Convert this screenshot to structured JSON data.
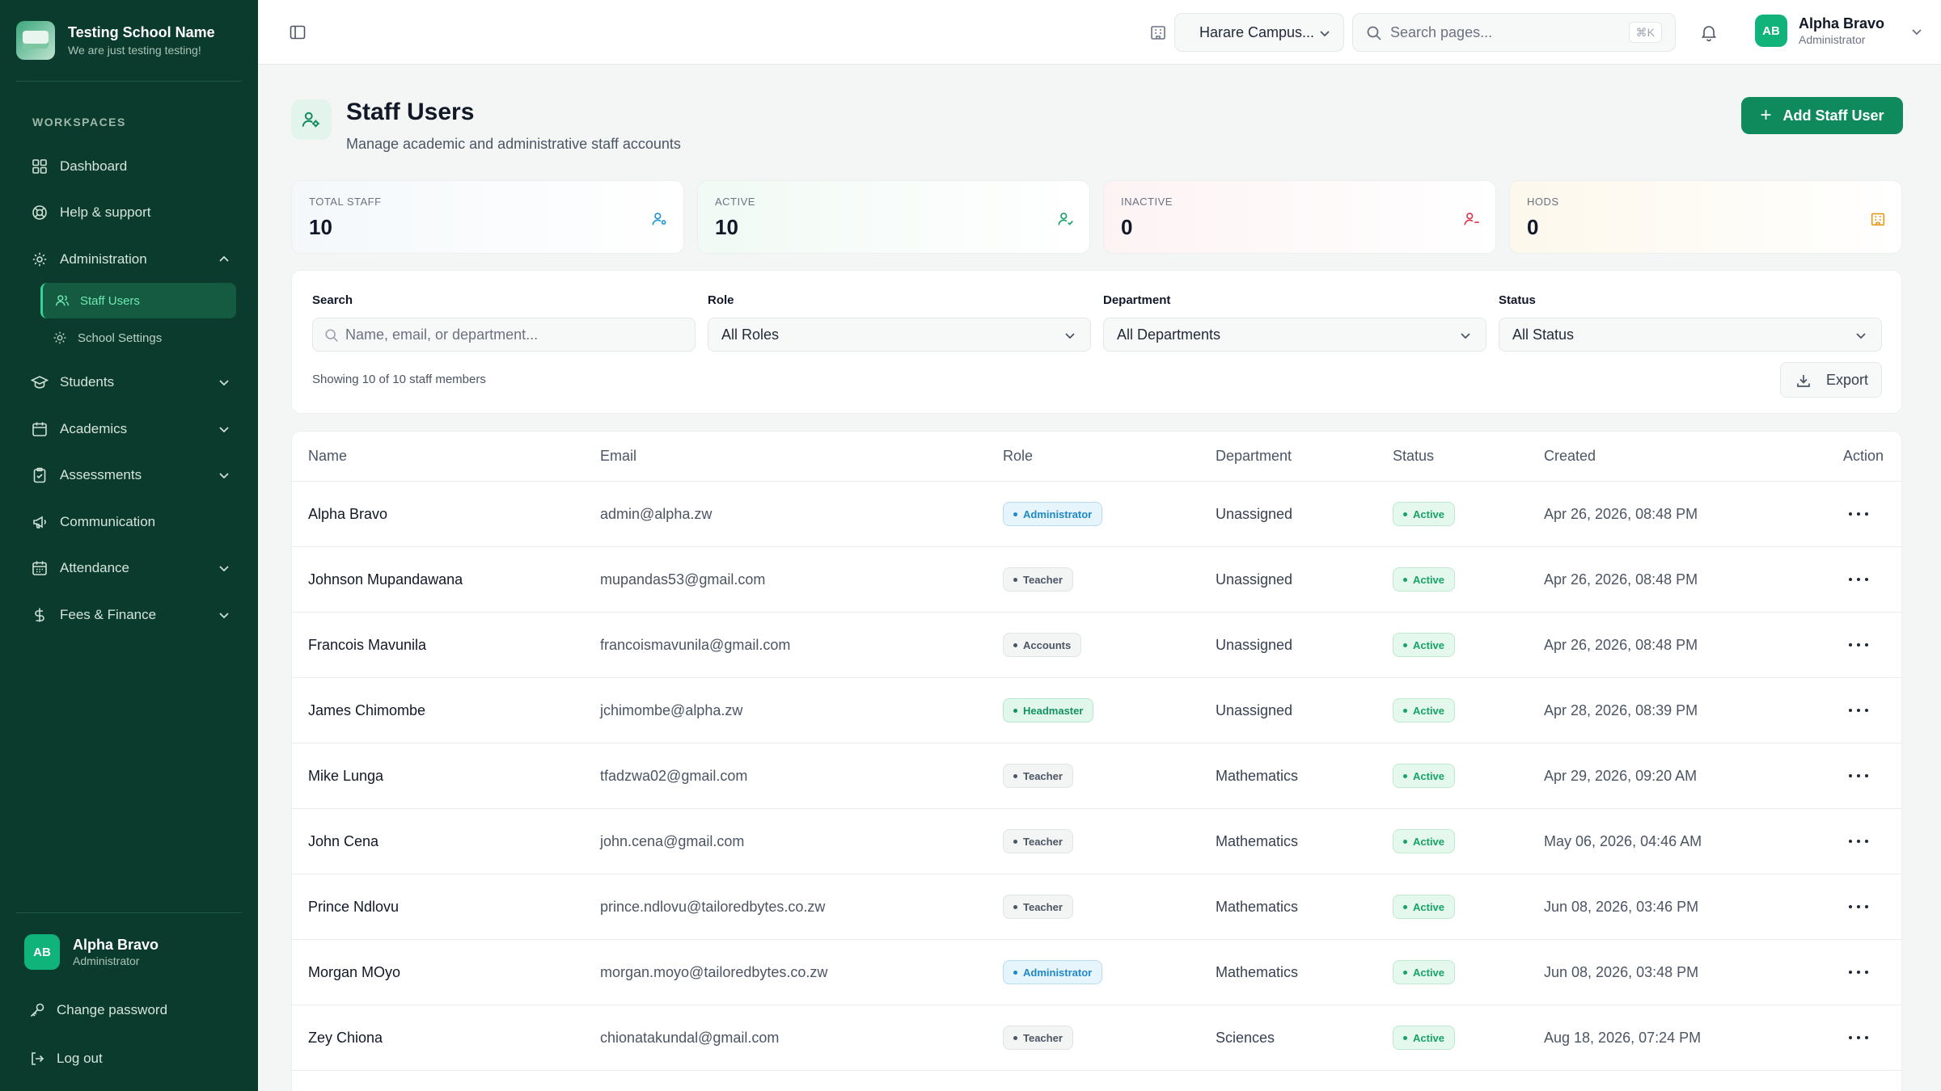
{
  "brand": {
    "name": "Testing School Name",
    "tagline": "We are just testing testing!"
  },
  "sidebar": {
    "section_label": "WORKSPACES",
    "items": [
      {
        "label": "Dashboard",
        "icon": "grid-icon"
      },
      {
        "label": "Help & support",
        "icon": "lifebuoy-icon"
      },
      {
        "label": "Administration",
        "icon": "gear-icon",
        "expanded": true,
        "children": [
          {
            "label": "Staff Users",
            "icon": "users-icon",
            "active": true
          },
          {
            "label": "School Settings",
            "icon": "gear-icon"
          }
        ]
      },
      {
        "label": "Students",
        "icon": "graduation-cap-icon"
      },
      {
        "label": "Academics",
        "icon": "calendar-icon"
      },
      {
        "label": "Assessments",
        "icon": "clipboard-check-icon"
      },
      {
        "label": "Communication",
        "icon": "megaphone-icon"
      },
      {
        "label": "Attendance",
        "icon": "calendar-grid-icon"
      },
      {
        "label": "Fees & Finance",
        "icon": "dollar-icon"
      }
    ],
    "user": {
      "initials": "AB",
      "name": "Alpha Bravo",
      "role": "Administrator"
    },
    "change_password": "Change password",
    "logout": "Log out"
  },
  "topbar": {
    "campus": "Harare Campus...",
    "search_placeholder": "Search pages...",
    "shortcut": "⌘K",
    "user": {
      "initials": "AB",
      "name": "Alpha Bravo",
      "role": "Administrator"
    }
  },
  "page": {
    "title": "Staff Users",
    "subtitle": "Manage academic and administrative staff accounts",
    "add_button": "Add Staff User"
  },
  "stats": [
    {
      "label": "TOTAL STAFF",
      "value": "10",
      "icon": "users-icon",
      "color": "#2196d6"
    },
    {
      "label": "ACTIVE",
      "value": "10",
      "icon": "user-check-icon",
      "color": "#16a365"
    },
    {
      "label": "INACTIVE",
      "value": "0",
      "icon": "user-minus-icon",
      "color": "#e0354f"
    },
    {
      "label": "HODS",
      "value": "0",
      "icon": "building-icon",
      "color": "#e59a1a"
    }
  ],
  "filters": {
    "search_label": "Search",
    "search_placeholder": "Name, email, or department...",
    "role_label": "Role",
    "role_value": "All Roles",
    "department_label": "Department",
    "department_value": "All Departments",
    "status_label": "Status",
    "status_value": "All Status",
    "showing": "Showing 10 of 10 staff members",
    "export": "Export"
  },
  "table": {
    "columns": [
      "Name",
      "Email",
      "Role",
      "Department",
      "Status",
      "Created",
      "Action"
    ],
    "rows": [
      {
        "name": "Alpha Bravo",
        "email": "admin@alpha.zw",
        "role": "Administrator",
        "role_kind": "admin",
        "department": "Unassigned",
        "status": "Active",
        "created": "Apr 26, 2026, 08:48 PM"
      },
      {
        "name": "Johnson Mupandawana",
        "email": "mupandas53@gmail.com",
        "role": "Teacher",
        "role_kind": "teacher",
        "department": "Unassigned",
        "status": "Active",
        "created": "Apr 26, 2026, 08:48 PM"
      },
      {
        "name": "Francois Mavunila",
        "email": "francoismavunila@gmail.com",
        "role": "Accounts",
        "role_kind": "teacher",
        "department": "Unassigned",
        "status": "Active",
        "created": "Apr 26, 2026, 08:48 PM"
      },
      {
        "name": "James Chimombe",
        "email": "jchimombe@alpha.zw",
        "role": "Headmaster",
        "role_kind": "head",
        "department": "Unassigned",
        "status": "Active",
        "created": "Apr 28, 2026, 08:39 PM"
      },
      {
        "name": "Mike Lunga",
        "email": "tfadzwa02@gmail.com",
        "role": "Teacher",
        "role_kind": "teacher",
        "department": "Mathematics",
        "status": "Active",
        "created": "Apr 29, 2026, 09:20 AM"
      },
      {
        "name": "John Cena",
        "email": "john.cena@gmail.com",
        "role": "Teacher",
        "role_kind": "teacher",
        "department": "Mathematics",
        "status": "Active",
        "created": "May 06, 2026, 04:46 AM"
      },
      {
        "name": "Prince Ndlovu",
        "email": "prince.ndlovu@tailoredbytes.co.zw",
        "role": "Teacher",
        "role_kind": "teacher",
        "department": "Mathematics",
        "status": "Active",
        "created": "Jun 08, 2026, 03:46 PM"
      },
      {
        "name": "Morgan MOyo",
        "email": "morgan.moyo@tailoredbytes.co.zw",
        "role": "Administrator",
        "role_kind": "admin",
        "department": "Mathematics",
        "status": "Active",
        "created": "Jun 08, 2026, 03:48 PM"
      },
      {
        "name": "Zey Chiona",
        "email": "chionatakundal@gmail.com",
        "role": "Teacher",
        "role_kind": "teacher",
        "department": "Sciences",
        "status": "Active",
        "created": "Aug 18, 2026, 07:24 PM"
      }
    ]
  }
}
